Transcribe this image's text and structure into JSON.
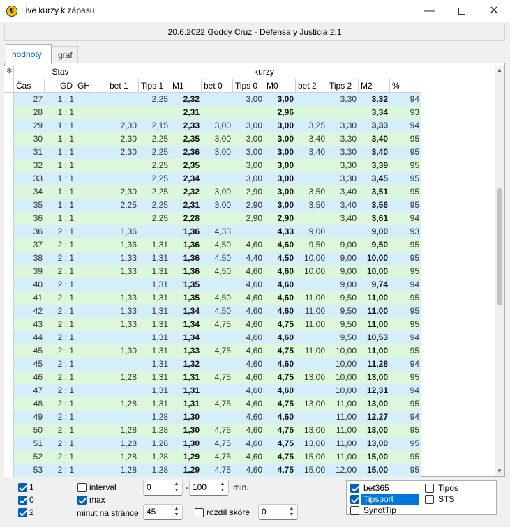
{
  "window": {
    "title": "Live kurzy k zápasu",
    "min": "—",
    "close": "✕"
  },
  "match": {
    "title": "20.6.2022 Godoy Cruz - Defensa y Justicia  2:1"
  },
  "tabs": [
    {
      "label": "hodnoty",
      "active": true
    },
    {
      "label": "graf",
      "active": false
    }
  ],
  "table": {
    "corner": "✻",
    "group_headers": {
      "stav": "Stav",
      "kurzy": "kurzy"
    },
    "columns": [
      "Čas",
      "GD",
      "GH",
      "bet 1",
      "Tips 1",
      "M1",
      "bet 0",
      "Tips 0",
      "M0",
      "bet 2",
      "Tips 2",
      "M2",
      "%"
    ],
    "rows": [
      [
        "27",
        "1 : 1",
        "",
        "2,25",
        "2,32",
        "",
        "3,00",
        "3,00",
        "",
        "3,30",
        "3,32",
        "94"
      ],
      [
        "28",
        "1 : 1",
        "",
        "",
        "2,31",
        "",
        "",
        "2,96",
        "",
        "",
        "3,34",
        "93"
      ],
      [
        "29",
        "1 : 1",
        "2,30",
        "2,15",
        "2,33",
        "3,00",
        "3,00",
        "3,00",
        "3,25",
        "3,30",
        "3,33",
        "94"
      ],
      [
        "30",
        "1 : 1",
        "2,30",
        "2,25",
        "2,35",
        "3,00",
        "3,00",
        "3,00",
        "3,40",
        "3,30",
        "3,40",
        "95"
      ],
      [
        "31",
        "1 : 1",
        "2,30",
        "2,25",
        "2,36",
        "3,00",
        "3,00",
        "3,00",
        "3,40",
        "3,30",
        "3,40",
        "95"
      ],
      [
        "32",
        "1 : 1",
        "",
        "2,25",
        "2,35",
        "",
        "3,00",
        "3,00",
        "",
        "3,30",
        "3,39",
        "95"
      ],
      [
        "33",
        "1 : 1",
        "",
        "2,25",
        "2,34",
        "",
        "3,00",
        "3,00",
        "",
        "3,30",
        "3,45",
        "95"
      ],
      [
        "34",
        "1 : 1",
        "2,30",
        "2,25",
        "2,32",
        "3,00",
        "2,90",
        "3,00",
        "3,50",
        "3,40",
        "3,51",
        "95"
      ],
      [
        "35",
        "1 : 1",
        "2,25",
        "2,25",
        "2,31",
        "3,00",
        "2,90",
        "3,00",
        "3,50",
        "3,40",
        "3,56",
        "95"
      ],
      [
        "36",
        "1 : 1",
        "",
        "2,25",
        "2,28",
        "",
        "2,90",
        "2,90",
        "",
        "3,40",
        "3,61",
        "94"
      ],
      [
        "36",
        "2 : 1",
        "1,36",
        "",
        "1,36",
        "4,33",
        "",
        "4,33",
        "9,00",
        "",
        "9,00",
        "93"
      ],
      [
        "37",
        "2 : 1",
        "1,36",
        "1,31",
        "1,36",
        "4,50",
        "4,60",
        "4,60",
        "9,50",
        "9,00",
        "9,50",
        "95"
      ],
      [
        "38",
        "2 : 1",
        "1,33",
        "1,31",
        "1,36",
        "4,50",
        "4,40",
        "4,50",
        "10,00",
        "9,00",
        "10,00",
        "95"
      ],
      [
        "39",
        "2 : 1",
        "1,33",
        "1,31",
        "1,36",
        "4,50",
        "4,60",
        "4,60",
        "10,00",
        "9,00",
        "10,00",
        "95"
      ],
      [
        "40",
        "2 : 1",
        "",
        "1,31",
        "1,35",
        "",
        "4,60",
        "4,60",
        "",
        "9,00",
        "9,74",
        "94"
      ],
      [
        "41",
        "2 : 1",
        "1,33",
        "1,31",
        "1,35",
        "4,50",
        "4,60",
        "4,60",
        "11,00",
        "9,50",
        "11,00",
        "95"
      ],
      [
        "42",
        "2 : 1",
        "1,33",
        "1,31",
        "1,34",
        "4,50",
        "4,60",
        "4,60",
        "11,00",
        "9,50",
        "11,00",
        "95"
      ],
      [
        "43",
        "2 : 1",
        "1,33",
        "1,31",
        "1,34",
        "4,75",
        "4,60",
        "4,75",
        "11,00",
        "9,50",
        "11,00",
        "95"
      ],
      [
        "44",
        "2 : 1",
        "",
        "1,31",
        "1,34",
        "",
        "4,60",
        "4,60",
        "",
        "9,50",
        "10,53",
        "94"
      ],
      [
        "45",
        "2 : 1",
        "1,30",
        "1,31",
        "1,33",
        "4,75",
        "4,60",
        "4,75",
        "11,00",
        "10,00",
        "11,00",
        "95"
      ],
      [
        "45",
        "2 : 1",
        "",
        "1,31",
        "1,32",
        "",
        "4,60",
        "4,60",
        "",
        "10,00",
        "11,28",
        "94"
      ],
      [
        "46",
        "2 : 1",
        "1,28",
        "1,31",
        "1,31",
        "4,75",
        "4,60",
        "4,75",
        "13,00",
        "10,00",
        "13,00",
        "95"
      ],
      [
        "47",
        "2 : 1",
        "",
        "1,31",
        "1,31",
        "",
        "4,60",
        "4,60",
        "",
        "10,00",
        "12,31",
        "94"
      ],
      [
        "48",
        "2 : 1",
        "1,28",
        "1,31",
        "1,31",
        "4,75",
        "4,60",
        "4,75",
        "13,00",
        "11,00",
        "13,00",
        "95"
      ],
      [
        "49",
        "2 : 1",
        "",
        "1,28",
        "1,30",
        "",
        "4,60",
        "4,60",
        "",
        "11,00",
        "12,27",
        "94"
      ],
      [
        "50",
        "2 : 1",
        "1,28",
        "1,28",
        "1,30",
        "4,75",
        "4,60",
        "4,75",
        "13,00",
        "11,00",
        "13,00",
        "95"
      ],
      [
        "51",
        "2 : 1",
        "1,28",
        "1,28",
        "1,30",
        "4,75",
        "4,60",
        "4,75",
        "13,00",
        "11,00",
        "13,00",
        "95"
      ],
      [
        "52",
        "2 : 1",
        "1,28",
        "1,28",
        "1,29",
        "4,75",
        "4,60",
        "4,75",
        "15,00",
        "11,00",
        "15,00",
        "95"
      ],
      [
        "53",
        "2 : 1",
        "1,28",
        "1,28",
        "1,29",
        "4,75",
        "4,60",
        "4,75",
        "15,00",
        "12,00",
        "15,00",
        "95"
      ]
    ],
    "row_colors": [
      "blue",
      "green",
      "blue",
      "green",
      "blue",
      "green",
      "blue",
      "green",
      "blue",
      "green",
      "blue",
      "green",
      "blue",
      "green",
      "blue",
      "green",
      "blue",
      "green",
      "blue",
      "green",
      "blue",
      "green",
      "blue",
      "green",
      "blue",
      "green",
      "blue",
      "green",
      "blue"
    ],
    "colors": {
      "blue": "#d4eefa",
      "green": "#dcf7dc"
    }
  },
  "filters": {
    "chk1": {
      "label": "1",
      "checked": true
    },
    "chk0": {
      "label": "0",
      "checked": true
    },
    "chk2": {
      "label": "2",
      "checked": true
    },
    "interval": {
      "label": "interval",
      "checked": false
    },
    "max": {
      "label": "max",
      "checked": true
    },
    "minut_label": "minut na stránce",
    "minut_value": "45",
    "from_value": "0",
    "dash": "-",
    "to_value": "100",
    "min_label": "min.",
    "rozdil": {
      "label": "rozdíl skóre",
      "checked": false
    },
    "rozdil_value": "0"
  },
  "sources": [
    {
      "label": "bet365",
      "checked": true
    },
    {
      "label": "Tipsport",
      "checked": true,
      "selected": true
    },
    {
      "label": "SynotTip",
      "checked": false
    },
    {
      "label": "Tipos",
      "checked": false
    },
    {
      "label": "STS",
      "checked": false
    }
  ]
}
